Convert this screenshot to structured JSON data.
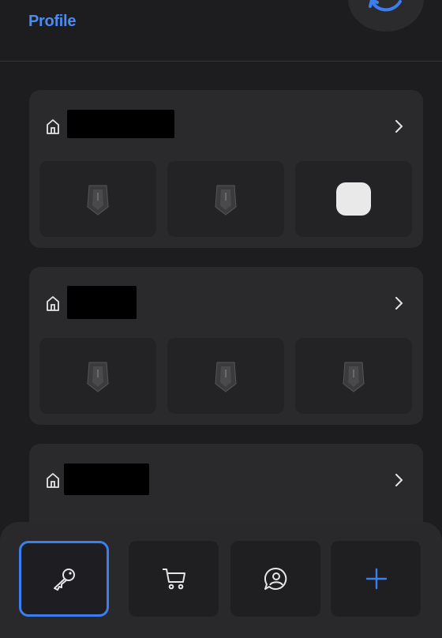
{
  "header": {
    "profile_label": "Profile",
    "sync_icon": "refresh-icon"
  },
  "groups": [
    {
      "home_icon": "home-icon",
      "name_redacted": true,
      "chevron_icon": "chevron-right-icon",
      "devices": [
        {
          "icon": "device-dark-icon"
        },
        {
          "icon": "device-dark-icon"
        },
        {
          "icon": "device-light-icon"
        }
      ]
    },
    {
      "home_icon": "home-icon",
      "name_redacted": true,
      "chevron_icon": "chevron-right-icon",
      "devices": [
        {
          "icon": "device-dark-icon"
        },
        {
          "icon": "device-dark-icon"
        },
        {
          "icon": "device-dark-icon"
        }
      ]
    },
    {
      "home_icon": "home-icon",
      "name_redacted": true,
      "chevron_icon": "chevron-right-icon",
      "devices": []
    }
  ],
  "bottom_nav": {
    "items": [
      {
        "icon": "wrench-icon",
        "selected": true
      },
      {
        "icon": "cart-icon",
        "selected": false
      },
      {
        "icon": "support-chat-icon",
        "selected": false
      },
      {
        "icon": "plus-icon",
        "selected": false
      }
    ],
    "accent_color": "#3a7ff0"
  },
  "colors": {
    "background": "#1d1d1f",
    "card": "#2a2a2c",
    "tile": "#232325",
    "link_blue": "#4a8cf2"
  }
}
